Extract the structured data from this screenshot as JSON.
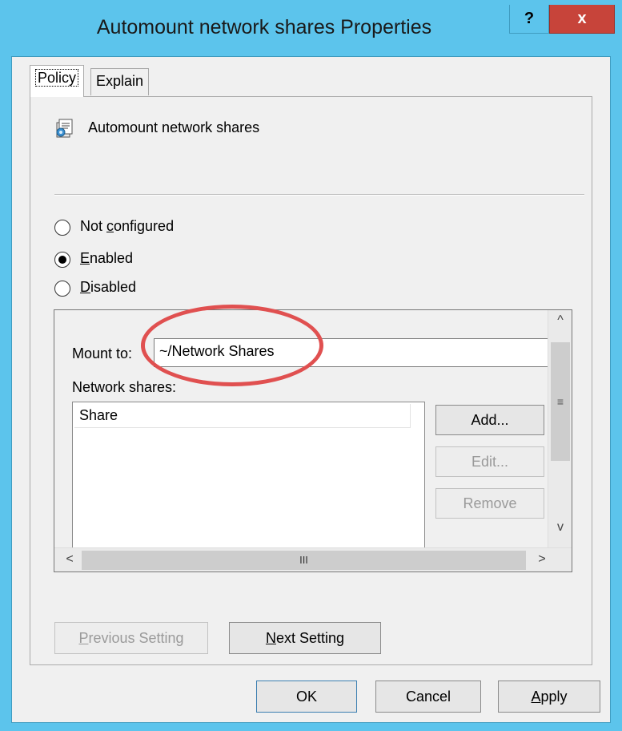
{
  "window": {
    "title": "Automount network shares Properties",
    "help_label": "?",
    "close_label": "x"
  },
  "tabs": [
    {
      "label": "Policy",
      "active": true
    },
    {
      "label": "Explain",
      "active": false
    }
  ],
  "policy": {
    "name": "Automount network shares",
    "icon": "policy-setting-icon"
  },
  "state": {
    "options": [
      {
        "label_pre": "Not ",
        "label_mnemonic": "c",
        "label_post": "onfigured",
        "selected": false
      },
      {
        "label_pre": "",
        "label_mnemonic": "E",
        "label_post": "nabled",
        "selected": true
      },
      {
        "label_pre": "",
        "label_mnemonic": "D",
        "label_post": "isabled",
        "selected": false
      }
    ]
  },
  "options_panel": {
    "mount_label": "Mount to:",
    "mount_value": "~/Network Shares",
    "shares_label": "Network shares:",
    "column_header": "Share",
    "shares": [],
    "add_label": "Add...",
    "edit_label": "Edit...",
    "remove_label": "Remove",
    "scroll_up": "^",
    "scroll_down": "v",
    "scroll_left": "<",
    "scroll_right": ">",
    "thumb_grip_h": "III",
    "thumb_grip_v": "≡"
  },
  "navigation": {
    "previous_mnemonic": "P",
    "previous_rest": "revious Setting",
    "next_mnemonic": "N",
    "next_rest": "ext Setting"
  },
  "footer": {
    "ok_label": "OK",
    "cancel_label": "Cancel",
    "apply_mnemonic": "A",
    "apply_rest": "pply"
  },
  "colors": {
    "titlebar": "#5cc4ec",
    "close_button": "#c7443a",
    "annotation": "#e05050"
  }
}
